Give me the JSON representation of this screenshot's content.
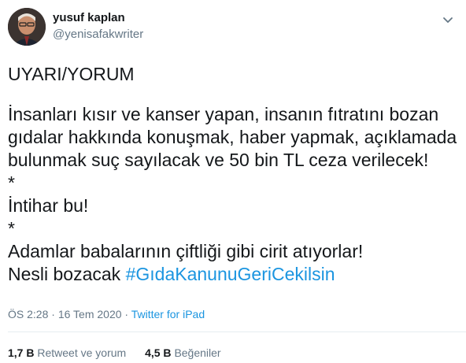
{
  "author": {
    "display_name": "yusuf kaplan",
    "handle": "@yenisafakwriter",
    "avatar_icon": "profile-photo"
  },
  "tweet": {
    "heading": "UYARI/YORUM",
    "lines": [
      "İnsanları kısır ve kanser yapan, insanın fıtratını bozan",
      "gıdalar hakkında konuşmak, haber yapmak, açıklamada",
      "bulunmak suç sayılacak ve 50 bin TL ceza verilecek!",
      "*",
      "İntihar bu!",
      "*",
      "Adamlar babalarının çiftliği gibi cirit atıyorlar!"
    ],
    "last_line_prefix": "Nesli bozacak ",
    "hashtag": "#GıdaKanunuGeriCekilsin"
  },
  "meta": {
    "time": "ÖS 2:28",
    "separator": "·",
    "date": "16 Tem 2020",
    "source": "Twitter for iPad"
  },
  "stats": {
    "retweets_count": "1,7 B",
    "retweets_label": "Retweet ve yorum",
    "likes_count": "4,5 B",
    "likes_label": "Beğeniler"
  },
  "colors": {
    "link": "#1b95e0",
    "muted": "#657786",
    "text": "#14171a",
    "divider": "#e6ecf0"
  },
  "icons": {
    "menu": "chevron-down-icon"
  }
}
